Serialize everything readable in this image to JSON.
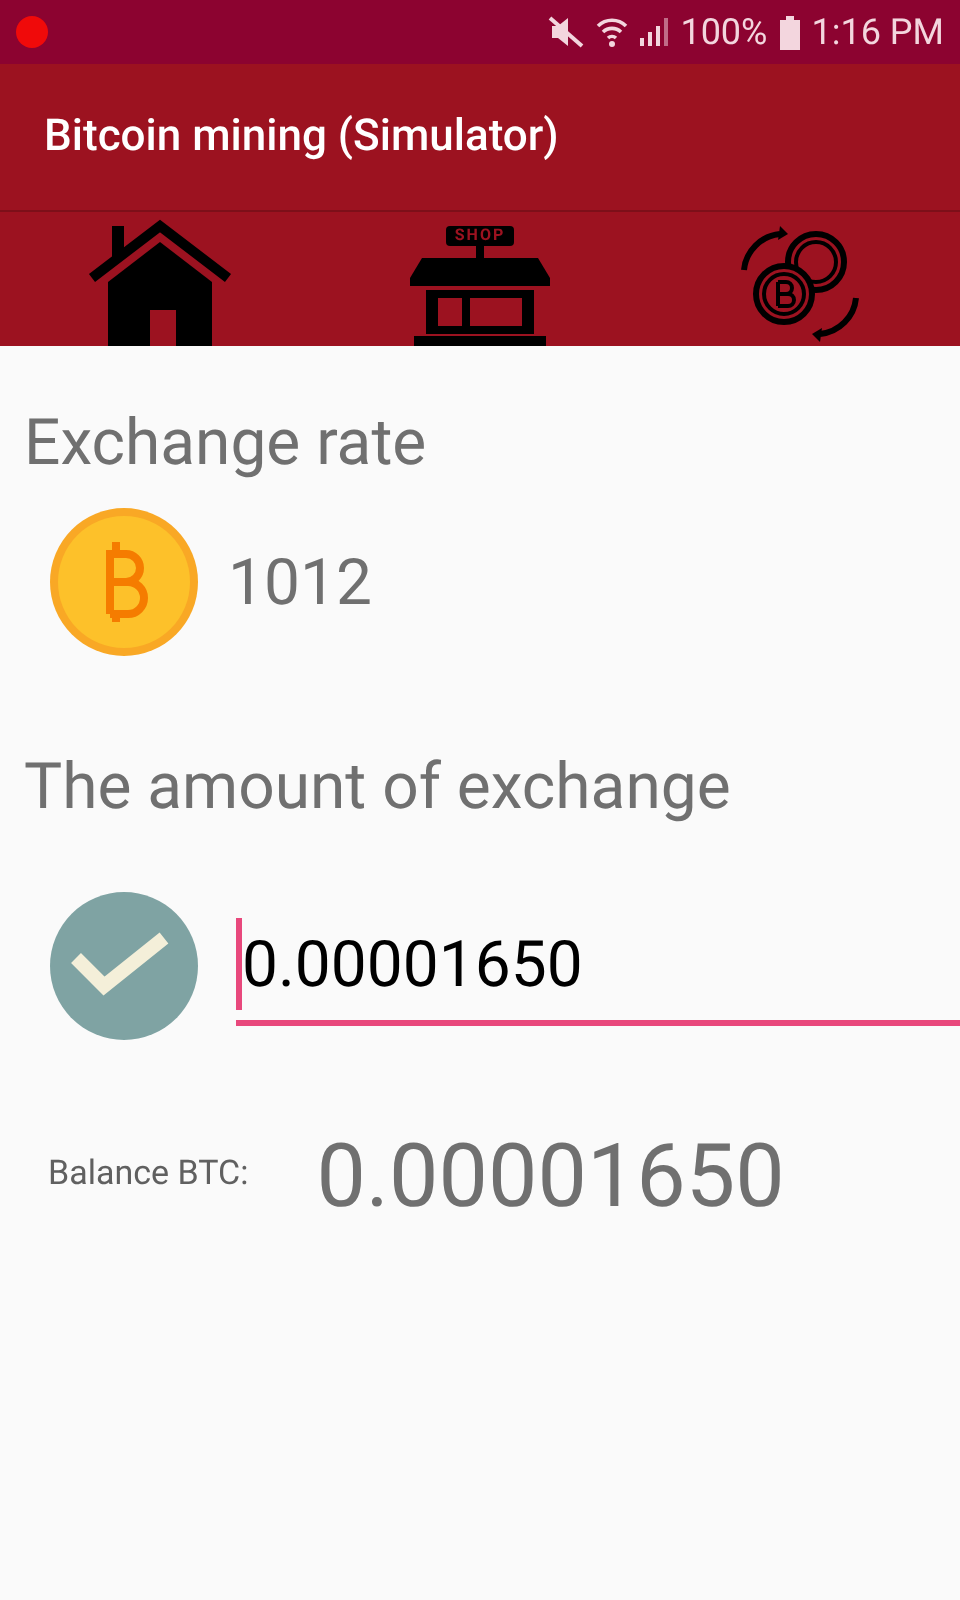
{
  "status_bar": {
    "battery": "100%",
    "time": "1:16 PM"
  },
  "app_bar": {
    "title": "Bitcoin mining (Simulator)"
  },
  "tabs": [
    {
      "kind": "home"
    },
    {
      "kind": "shop",
      "sign": "SHOP"
    },
    {
      "kind": "exchange"
    }
  ],
  "exchange_rate": {
    "heading": "Exchange rate",
    "value": "1012"
  },
  "exchange_amount": {
    "heading": "The amount of exchange",
    "value": "0.00001650",
    "focused": true
  },
  "balance": {
    "label": "Balance BTC:",
    "value": "0.00001650"
  }
}
